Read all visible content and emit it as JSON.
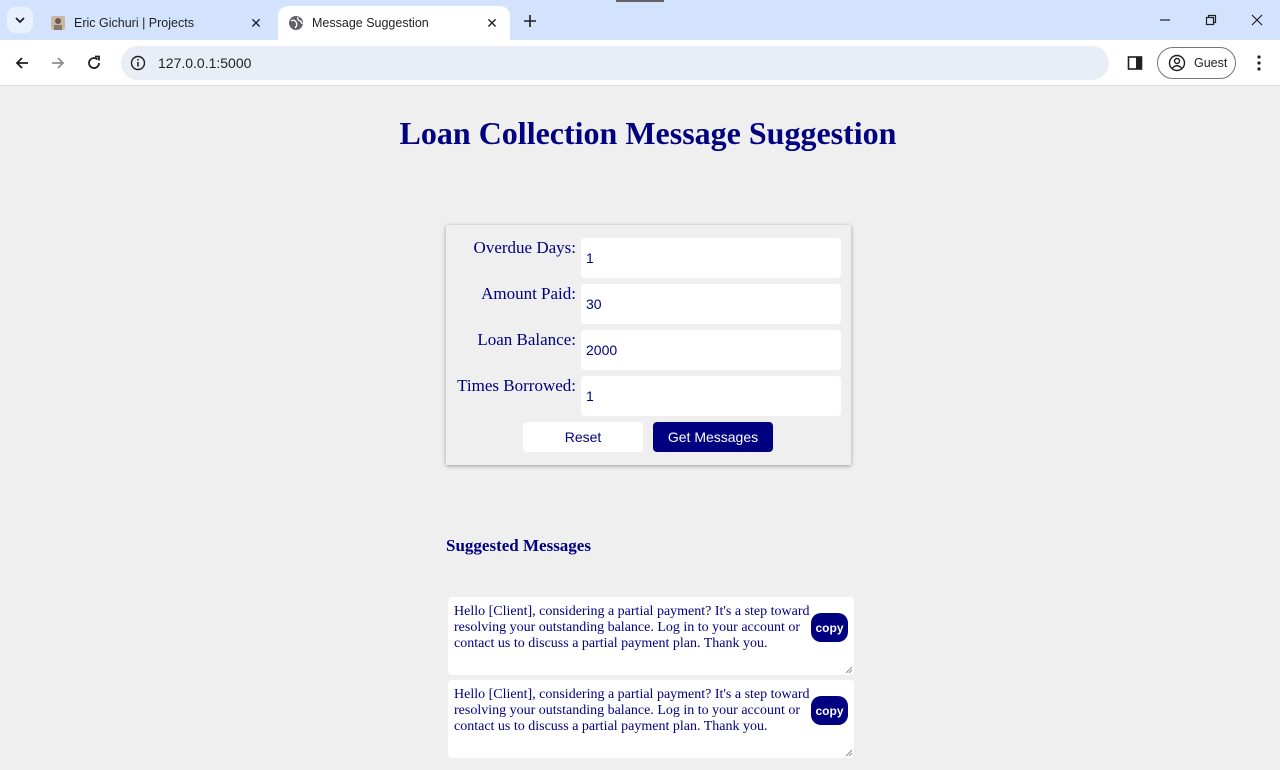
{
  "browser": {
    "tabs": [
      {
        "title": "Eric Gichuri | Projects",
        "active": false
      },
      {
        "title": "Message Suggestion",
        "active": true
      }
    ],
    "url": "127.0.0.1:5000",
    "profile_label": "Guest",
    "icons": {
      "tab_list": "chevron-down-icon",
      "new_tab": "plus-icon",
      "back": "back-arrow-icon",
      "forward": "forward-arrow-icon",
      "reload": "reload-icon",
      "site_info": "info-icon",
      "side_panel": "side-panel-icon",
      "profile": "person-icon",
      "menu": "kebab-menu-icon"
    }
  },
  "page": {
    "title": "Loan Collection Message Suggestion",
    "form": {
      "fields": [
        {
          "label": "Overdue Days:",
          "value": "1"
        },
        {
          "label": "Amount Paid:",
          "value": "30"
        },
        {
          "label": "Loan Balance:",
          "value": "2000"
        },
        {
          "label": "Times Borrowed:",
          "value": "1"
        }
      ],
      "reset_label": "Reset",
      "submit_label": "Get Messages"
    },
    "suggestions_title": "Suggested Messages",
    "messages": [
      {
        "text": "Hello [Client], considering a partial payment? It's a step toward resolving your outstanding balance. Log in to your account or contact us to discuss a partial payment plan. Thank you.",
        "copy_label": "copy"
      },
      {
        "text": "Hello [Client], considering a partial payment? It's a step toward resolving your outstanding balance. Log in to your account or contact us to discuss a partial payment plan. Thank you.",
        "copy_label": "copy"
      }
    ]
  },
  "colors": {
    "accent": "#000080",
    "page_background": "#efefef",
    "tabbar_background": "#d3e3fd"
  }
}
